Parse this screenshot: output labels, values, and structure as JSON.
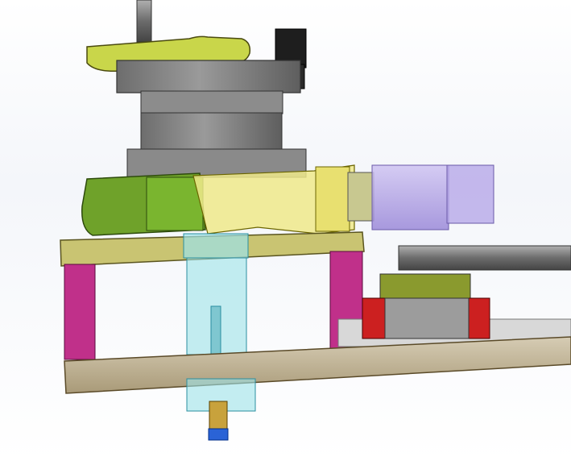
{
  "scene": {
    "type": "cad-3d-assembly-render",
    "palette": {
      "background": "#f4f6fa",
      "base_plate": "#c8bca2",
      "top_plate": "#c9c472",
      "pillars": "#c0308a",
      "motor_body": "#7f7f7f",
      "green_housing": "#6fa22a",
      "yellow_coupler": "#efe98a",
      "purple_cylinder": "#b7a8e8",
      "cyan_transparent": "#9de3e8",
      "rail": "#d8d8d8",
      "carriage_red": "#cc2020",
      "rod": "#8a8a8a",
      "black_sensor": "#1e1e1e",
      "brass_nozzle": "#c8a23c",
      "blue_tip": "#2a63d6"
    }
  }
}
